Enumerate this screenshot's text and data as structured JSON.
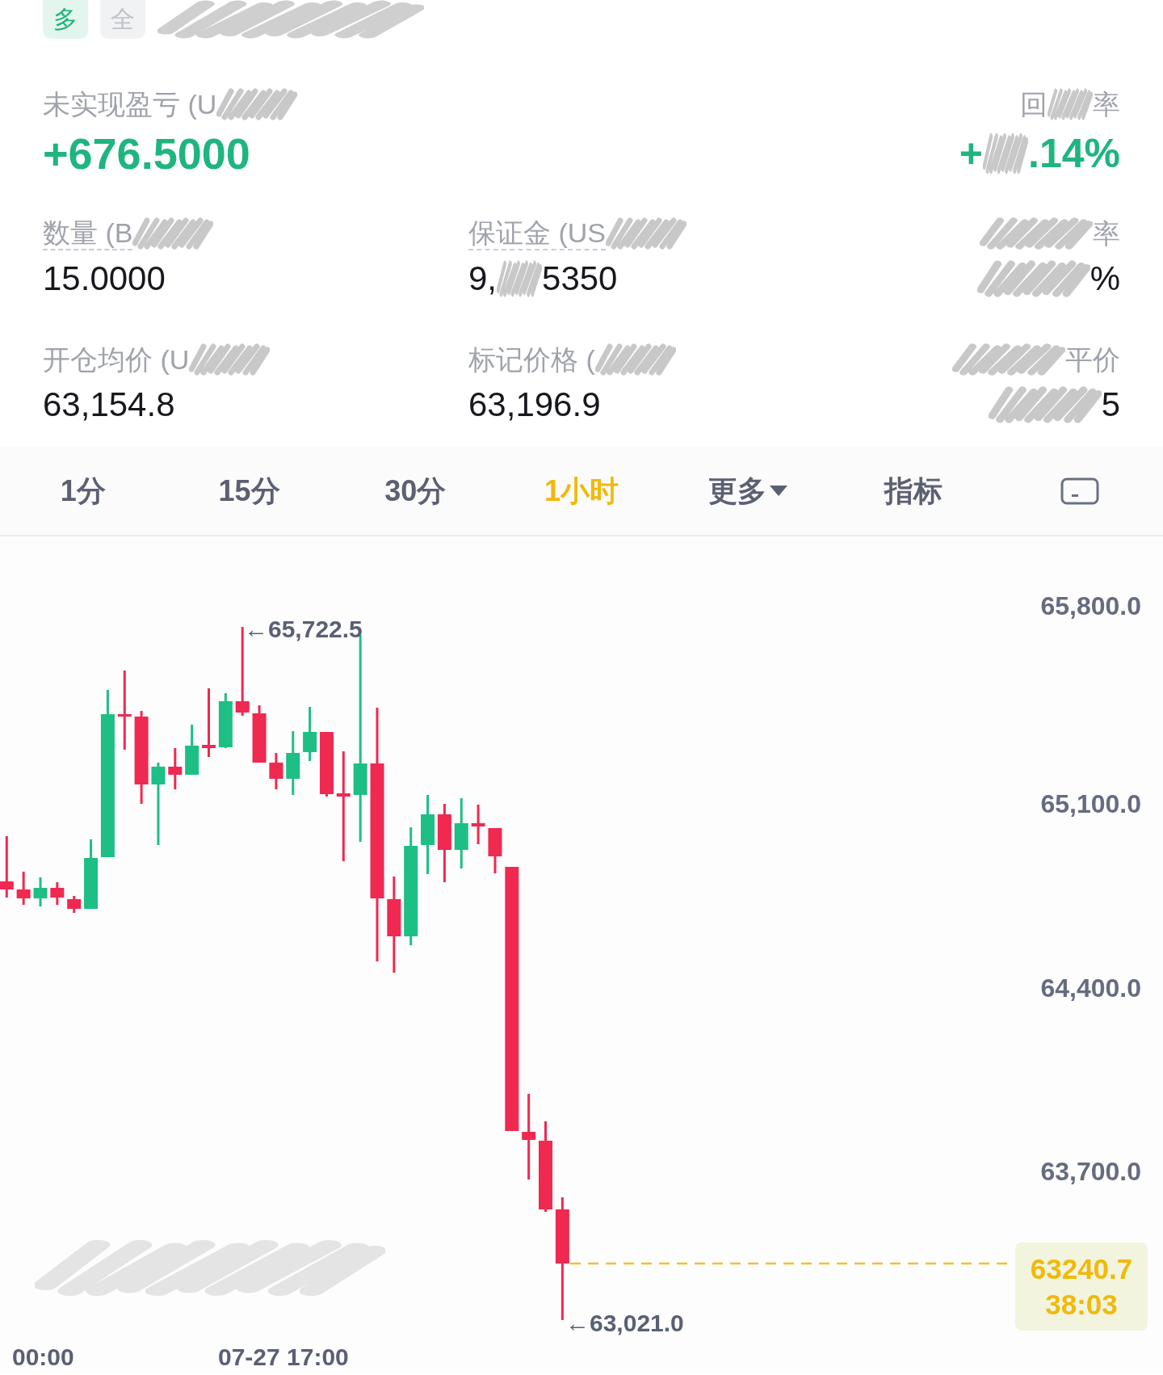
{
  "tags": [
    {
      "kind": "long",
      "label": "多",
      "scribbled": false
    },
    {
      "kind": "neutral",
      "label": "全",
      "scribbled": true
    }
  ],
  "pnl": {
    "label": [
      {
        "kind": "text",
        "text": "未实现盈亏 (U"
      },
      {
        "kind": "scribble"
      }
    ],
    "value": [
      {
        "kind": "text",
        "text": "+676.5000"
      }
    ]
  },
  "return_rate": {
    "label": [
      {
        "kind": "text",
        "text": "回"
      },
      {
        "kind": "scribble"
      },
      {
        "kind": "text",
        "text": "率"
      }
    ],
    "value": [
      {
        "kind": "text",
        "text": "+"
      },
      {
        "kind": "scribble"
      },
      {
        "kind": "text",
        "text": ".14%"
      }
    ]
  },
  "stats": [
    {
      "label": [
        {
          "kind": "text",
          "text": "数量 (B"
        },
        {
          "kind": "scribble"
        }
      ],
      "underlined": true,
      "value": [
        {
          "kind": "text",
          "text": "15.0000"
        }
      ]
    },
    {
      "label": [
        {
          "kind": "text",
          "text": "保证金 (US"
        },
        {
          "kind": "scribble"
        }
      ],
      "underlined": true,
      "value": [
        {
          "kind": "text",
          "text": "9,"
        },
        {
          "kind": "scribble"
        },
        {
          "kind": "text",
          "text": "5350"
        }
      ]
    },
    {
      "label": [
        {
          "kind": "scribble"
        },
        {
          "kind": "text",
          "text": "率"
        }
      ],
      "underlined": false,
      "value": [
        {
          "kind": "scribble"
        },
        {
          "kind": "text",
          "text": "%"
        }
      ]
    },
    {
      "label": [
        {
          "kind": "text",
          "text": "开仓均价 (U"
        },
        {
          "kind": "scribble"
        }
      ],
      "underlined": false,
      "value": [
        {
          "kind": "text",
          "text": "63,154.8"
        }
      ]
    },
    {
      "label": [
        {
          "kind": "text",
          "text": "标记价格 ("
        },
        {
          "kind": "scribble"
        }
      ],
      "underlined": false,
      "value": [
        {
          "kind": "text",
          "text": "63,196.9"
        }
      ]
    },
    {
      "label": [
        {
          "kind": "scribble"
        },
        {
          "kind": "text",
          "text": "平价"
        }
      ],
      "underlined": false,
      "value": [
        {
          "kind": "scribble"
        },
        {
          "kind": "text",
          "text": "5"
        }
      ]
    }
  ],
  "tabs": [
    {
      "kind": "text",
      "label": "1分",
      "selected": false
    },
    {
      "kind": "text",
      "label": "15分",
      "selected": false
    },
    {
      "kind": "text",
      "label": "30分",
      "selected": false
    },
    {
      "kind": "text",
      "label": "1小时",
      "selected": true
    },
    {
      "kind": "dropdown",
      "label": "更多",
      "selected": false
    },
    {
      "kind": "text",
      "label": "指标",
      "selected": false
    },
    {
      "kind": "icon",
      "selected": false
    }
  ],
  "chart": {
    "y_axis_labels": [
      "65,800.0",
      "65,100.0",
      "64,400.0",
      "63,700.0"
    ],
    "high_label": "←65,722.5",
    "low_label": "←63,021.0",
    "last_price": "63240.7",
    "countdown": "38:03",
    "x_axis_labels": [
      "00:00",
      "07-27 17:00"
    ]
  }
}
